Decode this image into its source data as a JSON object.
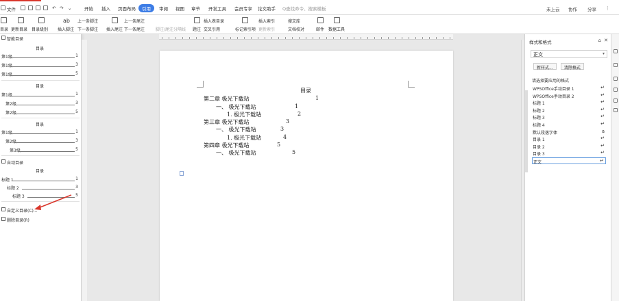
{
  "menubar": {
    "file": "文件",
    "tabs": [
      "开始",
      "插入",
      "页面布局",
      "引用",
      "审阅",
      "视图",
      "章节",
      "开发工具",
      "会员专享",
      "论文助手"
    ],
    "active_tab": "引用",
    "search_placeholder": "Q查找命令、搜索模板",
    "right": [
      "未上云",
      "协作",
      "分享"
    ]
  },
  "ribbon": {
    "toc_label": "目录",
    "update_toc": "更新目录",
    "toc_level": "目录级别",
    "insert_footnote": "插入脚注",
    "prev_footnote": "上一条脚注",
    "next_footnote": "下一条脚注",
    "insert_endnote": "插入尾注",
    "prev_endnote": "上一条尾注",
    "next_endnote_nav": "下一条尾注",
    "foot_endnote_sep": "脚注/尾注分隔线",
    "caption_title": "题注",
    "insert_caption_table": "插入表目录",
    "cross_ref": "交叉引用",
    "mark_index": "标记索引项",
    "insert_index": "插入索引",
    "update_index": "更新索引",
    "search_lit": "搜文库",
    "doc_check": "文档校对",
    "mail": "邮件",
    "office_tools": "数据工具"
  },
  "left_panel": {
    "smart_toc": "智能目录",
    "auto_toc": "自动目录",
    "toc_heading": "目录",
    "group1": [
      {
        "label": "第1级",
        "page": "1"
      },
      {
        "label": "第1级",
        "page": "3"
      },
      {
        "label": "第1级",
        "page": "5"
      }
    ],
    "group2": [
      {
        "label": "第1级",
        "page": "1"
      },
      {
        "label": "第2级",
        "page": "3"
      },
      {
        "label": "第2级",
        "page": "5"
      }
    ],
    "group3": [
      {
        "label": "第1级",
        "page": "1"
      },
      {
        "label": "第2级",
        "page": "3"
      },
      {
        "label": "第3级",
        "page": "5"
      }
    ],
    "group4": [
      {
        "label": "标题 1",
        "page": "1"
      },
      {
        "label": "标题 2",
        "page": "3"
      },
      {
        "label": "标题 3",
        "page": "5"
      }
    ],
    "custom_toc": "自定义目录(C)...",
    "delete_toc": "删除目录(R)"
  },
  "document": {
    "toc_title": "目录",
    "lines": [
      {
        "text": "第二章  极光下载站",
        "page": "1"
      },
      {
        "text": "一、  极光下载站",
        "page": "1"
      },
      {
        "text": "1.   极光下载站",
        "page": "2"
      },
      {
        "text": "第三章  极光下载站",
        "page": "3"
      },
      {
        "text": "一、  极光下载站",
        "page": "3"
      },
      {
        "text": "1.   极光下载站",
        "page": "4"
      },
      {
        "text": "第四章  极光下载站",
        "page": "5"
      },
      {
        "text": "一、  极光下载站",
        "page": "5"
      }
    ]
  },
  "styles_pane": {
    "title": "样式和格式",
    "current_style": "正文",
    "new_style": "新样式...",
    "clear_format": "清除格式",
    "apply_label": "请选择要应用的格式",
    "items": [
      {
        "name": "WPSOffice手动目录 1",
        "mark": "↵"
      },
      {
        "name": "WPSOffice手动目录 2",
        "mark": "↵"
      },
      {
        "name": "标题 1",
        "mark": "↵"
      },
      {
        "name": "标题 2",
        "mark": "↵"
      },
      {
        "name": "标题 3",
        "mark": "↵"
      },
      {
        "name": "标题 4",
        "mark": "↵"
      },
      {
        "name": "默认段落字体",
        "mark": "a"
      },
      {
        "name": "目录 1",
        "mark": "↵"
      },
      {
        "name": "目录 2",
        "mark": "↵"
      },
      {
        "name": "目录 3",
        "mark": "↵"
      },
      {
        "name": "正文",
        "mark": "↵"
      }
    ]
  },
  "colors": {
    "accent": "#3d7de6",
    "annotation_arrow": "#d9362b"
  }
}
